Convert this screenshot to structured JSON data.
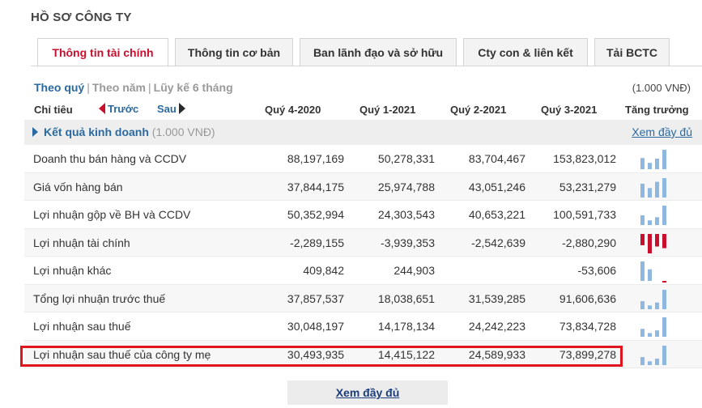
{
  "page_title": "HỒ SƠ CÔNG TY",
  "tabs": [
    {
      "label": "Thông tin tài chính",
      "active": true
    },
    {
      "label": "Thông tin cơ bản",
      "active": false
    },
    {
      "label": "Ban lãnh đạo và sở hữu",
      "active": false
    },
    {
      "label": "Cty con & liên kết",
      "active": false
    },
    {
      "label": "Tải BCTC",
      "active": false
    }
  ],
  "period": {
    "quarter": "Theo quý",
    "year": "Theo năm",
    "ytd": "Lũy kế 6 tháng",
    "separator": "|"
  },
  "unit": "(1.000 VNĐ)",
  "header": {
    "indicator": "Chỉ tiêu",
    "prev": "Trước",
    "next": "Sau",
    "columns": [
      "Quý 4-2020",
      "Quý 1-2021",
      "Quý 2-2021",
      "Quý 3-2021"
    ],
    "growth": "Tăng trưởng"
  },
  "section": {
    "title": "Kết quả kinh doanh",
    "unit": "(1.000 VNĐ)",
    "link": "Xem đầy đủ"
  },
  "rows": [
    {
      "label": "Doanh thu bán hàng và CCDV",
      "values": [
        "88,197,169",
        "50,278,331",
        "83,704,467",
        "153,823,012"
      ],
      "nums": [
        88197169,
        50278331,
        83704467,
        153823012
      ]
    },
    {
      "label": "Giá vốn hàng bán",
      "values": [
        "37,844,175",
        "25,974,788",
        "43,051,246",
        "53,231,279"
      ],
      "nums": [
        37844175,
        25974788,
        43051246,
        53231279
      ]
    },
    {
      "label": "Lợi nhuận gộp về BH và CCDV",
      "values": [
        "50,352,994",
        "24,303,543",
        "40,653,221",
        "100,591,733"
      ],
      "nums": [
        50352994,
        24303543,
        40653221,
        100591733
      ]
    },
    {
      "label": "Lợi nhuận tài chính",
      "values": [
        "-2,289,155",
        "-3,939,353",
        "-2,542,639",
        "-2,880,290"
      ],
      "nums": [
        -2289155,
        -3939353,
        -2542639,
        -2880290
      ]
    },
    {
      "label": "Lợi nhuận khác",
      "values": [
        "409,842",
        "244,903",
        "",
        "-53,606"
      ],
      "nums": [
        409842,
        244903,
        0,
        -53606
      ]
    },
    {
      "label": "Tổng lợi nhuận trước thuế",
      "values": [
        "37,857,537",
        "18,038,651",
        "31,539,285",
        "91,606,636"
      ],
      "nums": [
        37857537,
        18038651,
        31539285,
        91606636
      ]
    },
    {
      "label": "Lợi nhuận sau thuế",
      "values": [
        "30,048,197",
        "14,178,134",
        "24,242,223",
        "73,834,728"
      ],
      "nums": [
        30048197,
        14178134,
        24242223,
        73834728
      ]
    },
    {
      "label": "Lợi nhuận sau thuế của công ty mẹ",
      "values": [
        "30,493,935",
        "14,415,122",
        "24,589,933",
        "73,899,278"
      ],
      "nums": [
        30493935,
        14415122,
        24589933,
        73899278
      ]
    }
  ],
  "colors": {
    "positive": "#8fb8e0",
    "negative": "#c8102e",
    "highlight": "#e0141e"
  },
  "more_button": "Xem đầy đủ"
}
